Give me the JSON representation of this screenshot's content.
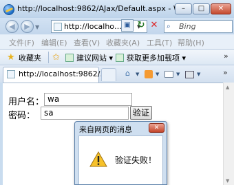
{
  "window": {
    "title": "http://localhost:9862/AJax/Default.aspx - Wind…",
    "minimize_glyph": "–",
    "maximize_glyph": "□",
    "close_glyph": "✕"
  },
  "addressbar": {
    "url": "http://localho…",
    "search_provider": "Bing"
  },
  "menu": {
    "items": [
      "文件(F)",
      "编辑(E)",
      "查看(V)",
      "收藏夹(A)",
      "工具(T)",
      "帮助(H)"
    ]
  },
  "favorites": {
    "label": "收藏夹",
    "items": [
      "建议网站 ▾",
      "获取更多加载项 ▾"
    ],
    "more": "»"
  },
  "tab": {
    "title": "http://localhost:9862/…",
    "more": "»"
  },
  "form": {
    "username_label": "用户名：",
    "username_value": "wa",
    "password_label": "密码：",
    "password_value": "sa",
    "verify_button": "验证"
  },
  "dialog": {
    "title": "来自网页的消息",
    "message": "验证失败！",
    "close_glyph": "✕"
  },
  "icons": {
    "app": "ie-icon",
    "warning": "warning-icon",
    "accent": "#c9dcef"
  }
}
